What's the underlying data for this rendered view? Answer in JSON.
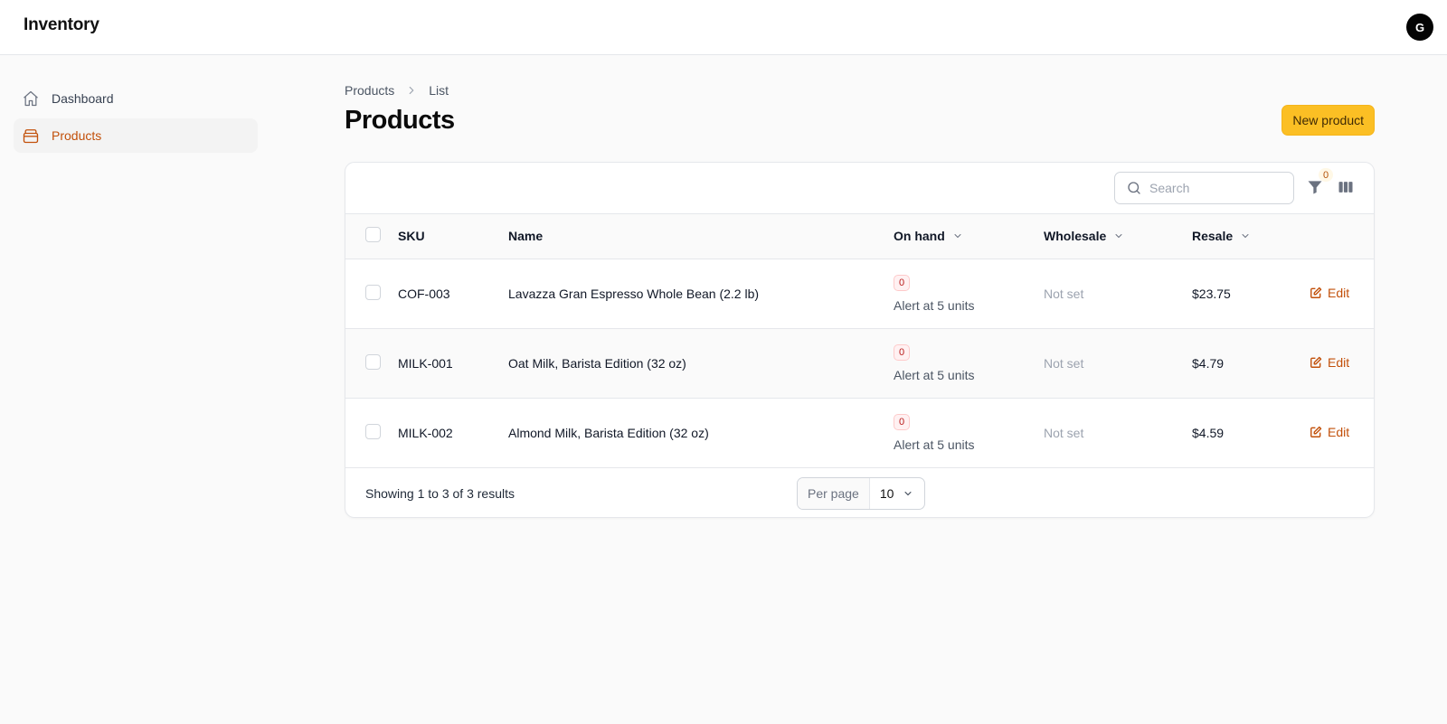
{
  "app": {
    "title": "Inventory",
    "avatar_initial": "G"
  },
  "sidebar": {
    "items": [
      {
        "label": "Dashboard",
        "icon": "home-icon",
        "active": false
      },
      {
        "label": "Products",
        "icon": "box-icon",
        "active": true
      }
    ]
  },
  "breadcrumb": {
    "items": [
      "Products",
      "List"
    ]
  },
  "page": {
    "title": "Products",
    "new_button": "New product"
  },
  "toolbar": {
    "search_placeholder": "Search",
    "filter_count": "0"
  },
  "table": {
    "headers": {
      "sku": "SKU",
      "name": "Name",
      "on_hand": "On hand",
      "wholesale": "Wholesale",
      "resale": "Resale"
    },
    "rows": [
      {
        "sku": "COF-003",
        "name": "Lavazza Gran Espresso Whole Bean (2.2 lb)",
        "on_hand": "0",
        "alert": "Alert at 5 units",
        "wholesale": "Not set",
        "resale": "$23.75",
        "action": "Edit"
      },
      {
        "sku": "MILK-001",
        "name": "Oat Milk, Barista Edition (32 oz)",
        "on_hand": "0",
        "alert": "Alert at 5 units",
        "wholesale": "Not set",
        "resale": "$4.79",
        "action": "Edit"
      },
      {
        "sku": "MILK-002",
        "name": "Almond Milk, Barista Edition (32 oz)",
        "on_hand": "0",
        "alert": "Alert at 5 units",
        "wholesale": "Not set",
        "resale": "$4.59",
        "action": "Edit"
      }
    ]
  },
  "footer": {
    "showing": "Showing 1 to 3 of 3 results",
    "per_page_label": "Per page",
    "per_page_value": "10"
  },
  "colors": {
    "accent": "#c2500a",
    "primary_button": "#fbbf24",
    "badge_red": "#b91c1c"
  }
}
